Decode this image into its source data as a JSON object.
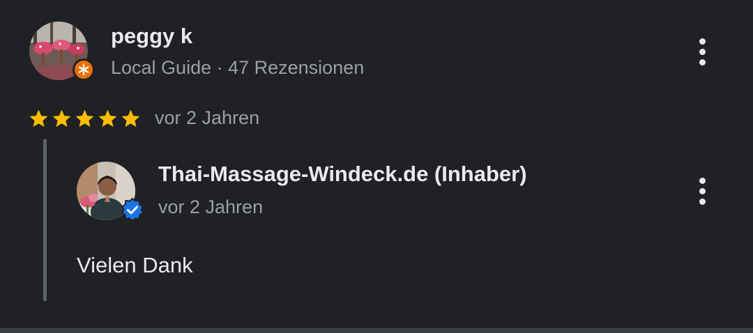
{
  "review": {
    "reviewer_name": "peggy k",
    "reviewer_meta": "Local Guide · 47 Rezensionen",
    "avatar_icon": "flower-photo-avatar",
    "badge_icon": "local-guide-star-icon",
    "rating": 5,
    "rating_max": 5,
    "date": "vor 2 Jahren",
    "menu_icon": "more-vert-icon"
  },
  "reply": {
    "owner_name": "Thai-Massage-Windeck.de (Inhaber)",
    "date": "vor 2 Jahren",
    "text": "Vielen Dank",
    "avatar_icon": "owner-photo-avatar",
    "badge_icon": "verified-check-icon",
    "menu_icon": "more-vert-icon"
  },
  "colors": {
    "background": "#202124",
    "star": "#fbbc04",
    "guide_badge": "#e8710a",
    "verified_badge": "#1a73e8",
    "primary_text": "#e8eaed",
    "secondary_text": "#9aa0a6"
  }
}
